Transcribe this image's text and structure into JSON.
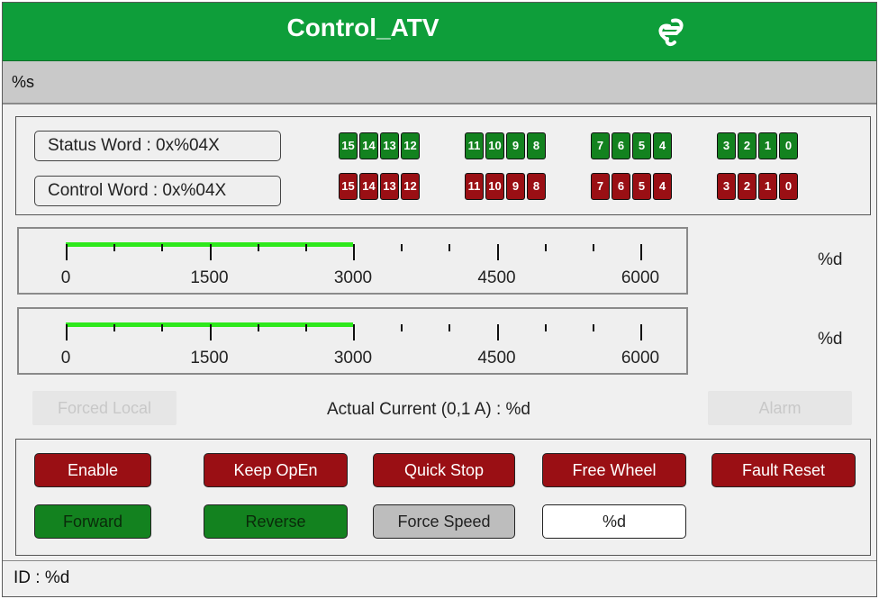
{
  "header": {
    "title": "Control_ATV",
    "logo_icon": "link-icon"
  },
  "status_line": "%s",
  "words": {
    "status_label": "Status Word : 0x%04X",
    "control_label": "Control Word : 0x%04X",
    "bit_groups": [
      [
        "15",
        "14",
        "13",
        "12"
      ],
      [
        "11",
        "10",
        "9",
        "8"
      ],
      [
        "7",
        "6",
        "5",
        "4"
      ],
      [
        "3",
        "2",
        "1",
        "0"
      ]
    ],
    "status_color": "#13821f",
    "control_color": "#9a0f14"
  },
  "gauges": [
    {
      "value": 3000,
      "min": 0,
      "max": 6000,
      "tick_labels": [
        "0",
        "1500",
        "3000",
        "4500",
        "6000"
      ],
      "readout": "%d"
    },
    {
      "value": 3000,
      "min": 0,
      "max": 6000,
      "tick_labels": [
        "0",
        "1500",
        "3000",
        "4500",
        "6000"
      ],
      "readout": "%d"
    }
  ],
  "indicators": {
    "forced_local": "Forced Local",
    "actual_current": "Actual Current (0,1 A) : %d",
    "alarm": "Alarm"
  },
  "commands": {
    "row1": [
      "Enable",
      "Keep OpEn",
      "Quick Stop",
      "Free Wheel",
      "Fault Reset"
    ],
    "forward": "Forward",
    "reverse": "Reverse",
    "force_speed": "Force Speed",
    "speed_value": "%d"
  },
  "footer": {
    "id": "ID : %d"
  }
}
